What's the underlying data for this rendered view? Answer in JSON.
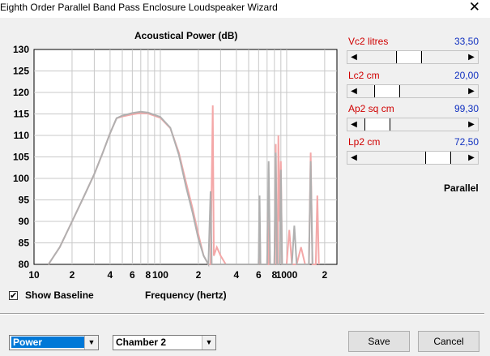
{
  "window": {
    "title": "Eighth Order Parallel Band Pass Enclosure Loudspeaker Wizard",
    "close_glyph": "✕"
  },
  "chart": {
    "title": "Acoustical Power (dB)",
    "xlabel": "Frequency (hertz)",
    "y_ticks": [
      "130",
      "125",
      "120",
      "115",
      "110",
      "105",
      "100",
      "95",
      "90",
      "85",
      "80"
    ],
    "x_ticks": [
      "10",
      "2",
      "4",
      "6",
      "8",
      "100",
      "2",
      "4",
      "6",
      "8",
      "1000",
      "2"
    ]
  },
  "chart_data": {
    "type": "line",
    "title": "Acoustical Power (dB)",
    "xlabel": "Frequency (hertz)",
    "ylabel": "",
    "xscale": "log",
    "xlim": [
      10,
      2500
    ],
    "ylim": [
      80,
      130
    ],
    "grid": true,
    "series": [
      {
        "color": "#f4a8a8",
        "points": [
          [
            13,
            80
          ],
          [
            16,
            84
          ],
          [
            20,
            90
          ],
          [
            25,
            96
          ],
          [
            30,
            101
          ],
          [
            35,
            106
          ],
          [
            40,
            110.5
          ],
          [
            45,
            114
          ],
          [
            50,
            114.4
          ],
          [
            60,
            114.9
          ],
          [
            70,
            115.2
          ],
          [
            80,
            115.1
          ],
          [
            100,
            114.1
          ],
          [
            120,
            111.7
          ],
          [
            140,
            106
          ],
          [
            160,
            99
          ],
          [
            180,
            93
          ],
          [
            200,
            87
          ],
          [
            220,
            82
          ],
          [
            240,
            79
          ],
          [
            250,
            79
          ],
          [
            260,
            117
          ],
          [
            265,
            82
          ],
          [
            280,
            84
          ],
          [
            300,
            82
          ],
          [
            330,
            80
          ],
          [
            600,
            80
          ],
          [
            610,
            90
          ],
          [
            620,
            80
          ],
          [
            700,
            80
          ],
          [
            710,
            92
          ],
          [
            720,
            80
          ],
          [
            800,
            80
          ],
          [
            820,
            108
          ],
          [
            830,
            80
          ],
          [
            850,
            80
          ],
          [
            860,
            110
          ],
          [
            880,
            90
          ],
          [
            900,
            104
          ],
          [
            920,
            80
          ],
          [
            1000,
            80
          ],
          [
            1050,
            88
          ],
          [
            1100,
            80
          ],
          [
            1200,
            80
          ],
          [
            1300,
            84
          ],
          [
            1400,
            80
          ],
          [
            1500,
            80
          ],
          [
            1550,
            106
          ],
          [
            1600,
            80
          ],
          [
            1700,
            80
          ],
          [
            1750,
            96
          ],
          [
            1800,
            80
          ]
        ]
      },
      {
        "color": "#b0b0b0",
        "points": [
          [
            13,
            80
          ],
          [
            16,
            84
          ],
          [
            20,
            90
          ],
          [
            25,
            96
          ],
          [
            30,
            101
          ],
          [
            35,
            106
          ],
          [
            40,
            110.5
          ],
          [
            45,
            114
          ],
          [
            50,
            114.6
          ],
          [
            60,
            115.2
          ],
          [
            70,
            115.5
          ],
          [
            80,
            115.3
          ],
          [
            100,
            114.3
          ],
          [
            120,
            111.8
          ],
          [
            140,
            105.5
          ],
          [
            160,
            98
          ],
          [
            180,
            92
          ],
          [
            200,
            86
          ],
          [
            220,
            82
          ],
          [
            240,
            80
          ],
          [
            250,
            97
          ],
          [
            255,
            80
          ],
          [
            600,
            80
          ],
          [
            610,
            96
          ],
          [
            620,
            80
          ],
          [
            700,
            80
          ],
          [
            720,
            104
          ],
          [
            740,
            80
          ],
          [
            800,
            80
          ],
          [
            820,
            106
          ],
          [
            840,
            80
          ],
          [
            880,
            80
          ],
          [
            900,
            102
          ],
          [
            920,
            80
          ],
          [
            1100,
            80
          ],
          [
            1150,
            89
          ],
          [
            1200,
            80
          ],
          [
            1500,
            80
          ],
          [
            1550,
            104
          ],
          [
            1600,
            80
          ]
        ]
      }
    ]
  },
  "params": [
    {
      "label": "Vc2  litres",
      "value": "33,50",
      "position": 0.45
    },
    {
      "label": "Lc2  cm",
      "value": "20,00",
      "position": 0.18
    },
    {
      "label": "Ap2  sq cm",
      "value": "99,30",
      "position": 0.05
    },
    {
      "label": "Lp2  cm",
      "value": "72,50",
      "position": 0.82
    }
  ],
  "mode": "Parallel",
  "show_baseline": {
    "label": "Show Baseline",
    "checked": true,
    "check_glyph": "✔"
  },
  "view_select": {
    "value": "Power"
  },
  "chamber_select": {
    "value": "Chamber 2"
  },
  "buttons": {
    "save": "Save",
    "cancel": "Cancel"
  },
  "colors": {
    "series_a": "#f4a8a8",
    "series_b": "#b0b0b0",
    "param_label": "#d00000",
    "param_value": "#1030c0"
  }
}
